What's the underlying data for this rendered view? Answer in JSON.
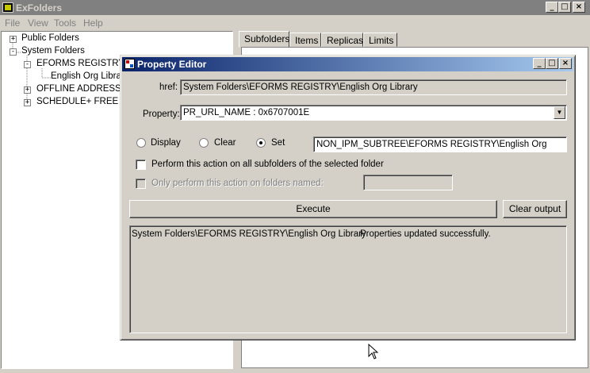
{
  "app": {
    "title": "ExFolders"
  },
  "menu": [
    "File",
    "View",
    "Tools",
    "Help"
  ],
  "tree": [
    {
      "label": "Public Folders",
      "expander": "+"
    },
    {
      "label": "System Folders",
      "expander": "-"
    },
    {
      "label": "EFORMS REGISTRY",
      "expander": "-"
    },
    {
      "label": "English Org Library",
      "expander": ""
    },
    {
      "label": "OFFLINE ADDRESS B",
      "expander": "+"
    },
    {
      "label": "SCHEDULE+ FREE B",
      "expander": "+"
    }
  ],
  "tabs": [
    "Subfolders",
    "Items",
    "Replicas",
    "Limits"
  ],
  "dialog": {
    "title": "Property Editor",
    "href_label": "href:",
    "href_value": "System Folders\\EFORMS REGISTRY\\English Org Library",
    "property_label": "Property:",
    "property_value": "PR_URL_NAME : 0x6707001E",
    "radios": [
      {
        "label": "Display",
        "selected": false
      },
      {
        "label": "Clear",
        "selected": false
      },
      {
        "label": "Set",
        "selected": true
      }
    ],
    "set_value": "NON_IPM_SUBTREE\\EFORMS REGISTRY\\English Org",
    "check_all_subfolders": "Perform this action on all subfolders of the selected folder",
    "check_named": "Only perform this action on folders named:",
    "execute_label": "Execute",
    "clear_output_label": "Clear output",
    "output_path": "System Folders\\EFORMS REGISTRY\\English Org Library",
    "output_message": "Properties updated successfully."
  }
}
